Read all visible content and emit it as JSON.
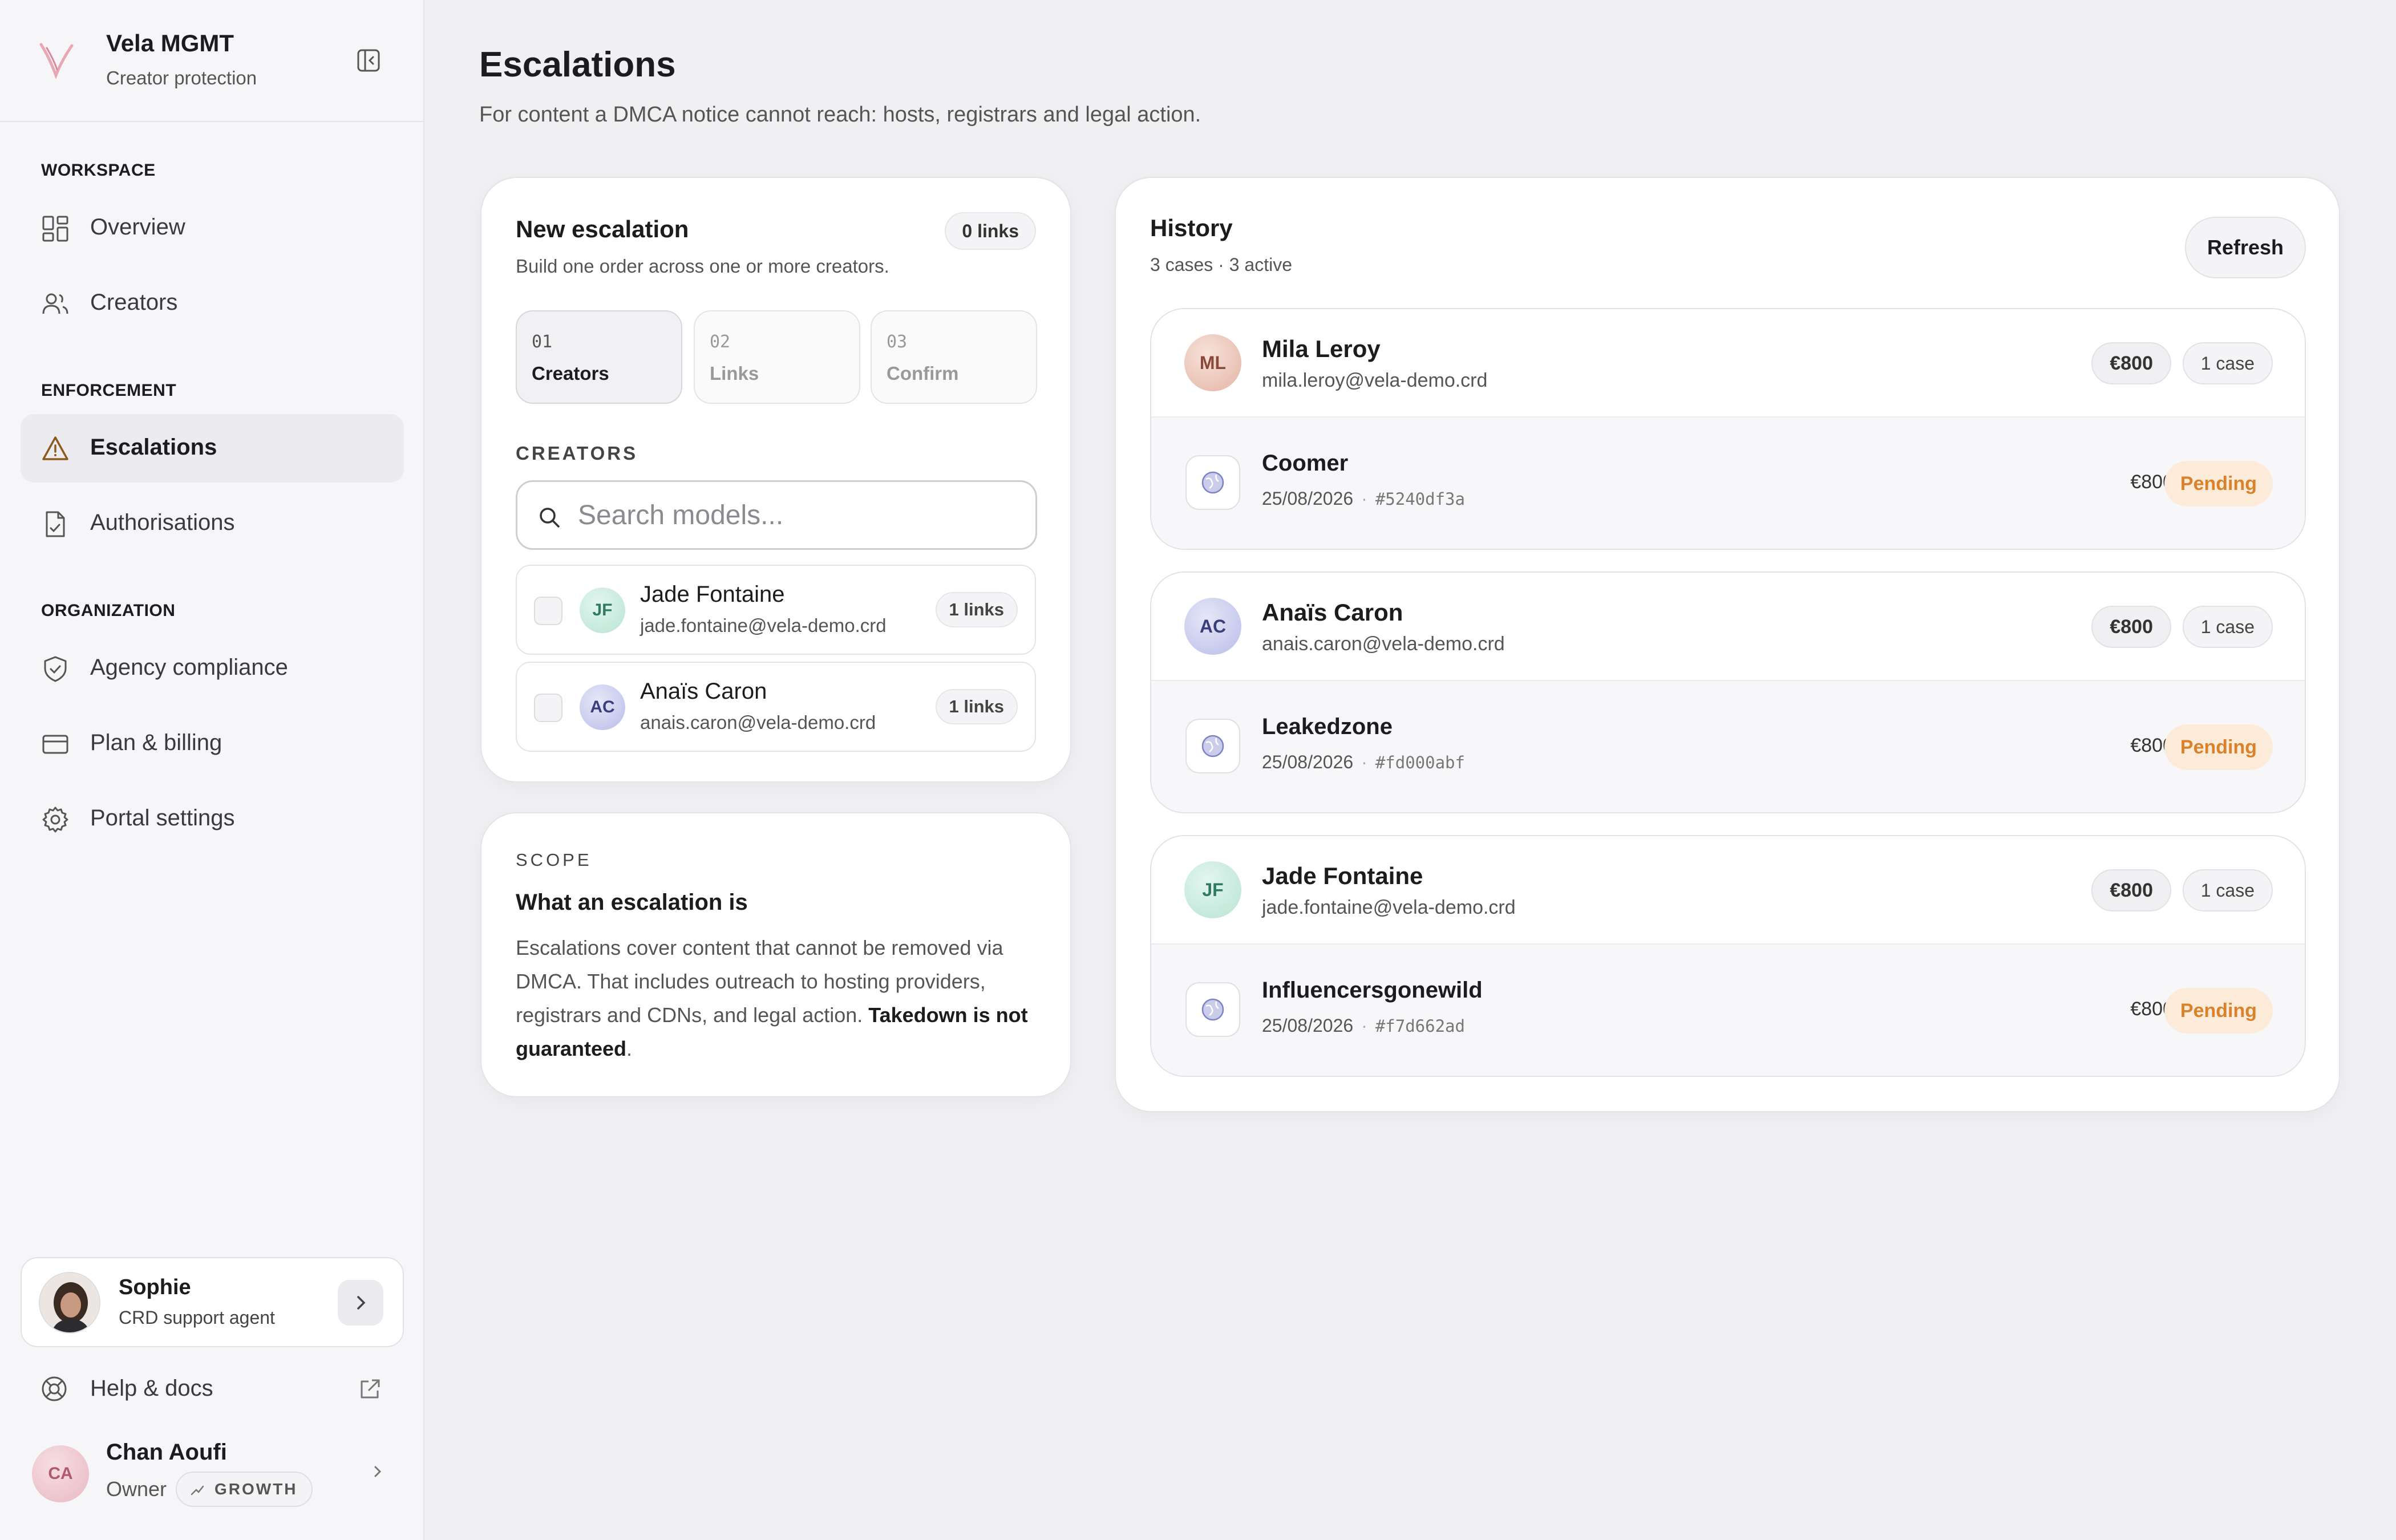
{
  "brand": {
    "name": "Vela MGMT",
    "subtitle": "Creator protection"
  },
  "sidebar": {
    "sections": [
      {
        "label": "WORKSPACE"
      },
      {
        "label": "ENFORCEMENT"
      },
      {
        "label": "ORGANIZATION"
      }
    ],
    "items": [
      {
        "label": "Overview",
        "icon": "grid-icon"
      },
      {
        "label": "Creators",
        "icon": "users-icon"
      },
      {
        "label": "Escalations",
        "icon": "warning-icon",
        "active": true
      },
      {
        "label": "Authorisations",
        "icon": "file-check-icon"
      },
      {
        "label": "Agency compliance",
        "icon": "shield-check-icon"
      },
      {
        "label": "Plan & billing",
        "icon": "credit-card-icon"
      },
      {
        "label": "Portal settings",
        "icon": "gear-icon"
      }
    ],
    "agent": {
      "name": "Sophie",
      "role": "CRD support agent"
    },
    "help": {
      "label": "Help & docs"
    },
    "user": {
      "initials": "CA",
      "name": "Chan Aoufi",
      "role": "Owner",
      "plan": "GROWTH"
    }
  },
  "page": {
    "title": "Escalations",
    "subtitle": "For content a DMCA notice cannot reach: hosts, registrars and legal action."
  },
  "new_escalation": {
    "title": "New escalation",
    "subtitle": "Build one order across one or more creators.",
    "links_count": "0 links",
    "steps": [
      {
        "num": "01",
        "label": "Creators",
        "active": true
      },
      {
        "num": "02",
        "label": "Links"
      },
      {
        "num": "03",
        "label": "Confirm"
      }
    ],
    "creators_label": "CREATORS",
    "search_placeholder": "Search models...",
    "creators": [
      {
        "initials": "JF",
        "name": "Jade Fontaine",
        "email": "jade.fontaine@vela-demo.crd",
        "links": "1 links"
      },
      {
        "initials": "AC",
        "name": "Anaïs Caron",
        "email": "anais.caron@vela-demo.crd",
        "links": "1 links"
      }
    ]
  },
  "scope": {
    "label": "SCOPE",
    "title": "What an escalation is",
    "body": "Escalations cover content that cannot be removed via DMCA. That includes outreach to hosting providers, registrars and CDNs, and legal action. ",
    "body_strong": "Takedown is not guaranteed",
    "body_end": "."
  },
  "history": {
    "title": "History",
    "summary": "3 cases · 3 active",
    "refresh_label": "Refresh",
    "cases": [
      {
        "initials": "ML",
        "name": "Mila Leroy",
        "email": "mila.leroy@vela-demo.crd",
        "price": "€800",
        "count": "1 case",
        "site": "Coomer",
        "date": "25/08/2026",
        "hash": "#5240df3a",
        "site_price": "€800",
        "status": "Pending"
      },
      {
        "initials": "AC",
        "name": "Anaïs Caron",
        "email": "anais.caron@vela-demo.crd",
        "price": "€800",
        "count": "1 case",
        "site": "Leakedzone",
        "date": "25/08/2026",
        "hash": "#fd000abf",
        "site_price": "€800",
        "status": "Pending"
      },
      {
        "initials": "JF",
        "name": "Jade Fontaine",
        "email": "jade.fontaine@vela-demo.crd",
        "price": "€800",
        "count": "1 case",
        "site": "Influencersgonewild",
        "date": "25/08/2026",
        "hash": "#f7d662ad",
        "site_price": "€800",
        "status": "Pending"
      }
    ]
  },
  "colors": {
    "pending_bg": "#fcebd9",
    "pending_text": "#d9822b",
    "active_nav": "#ececf0"
  }
}
